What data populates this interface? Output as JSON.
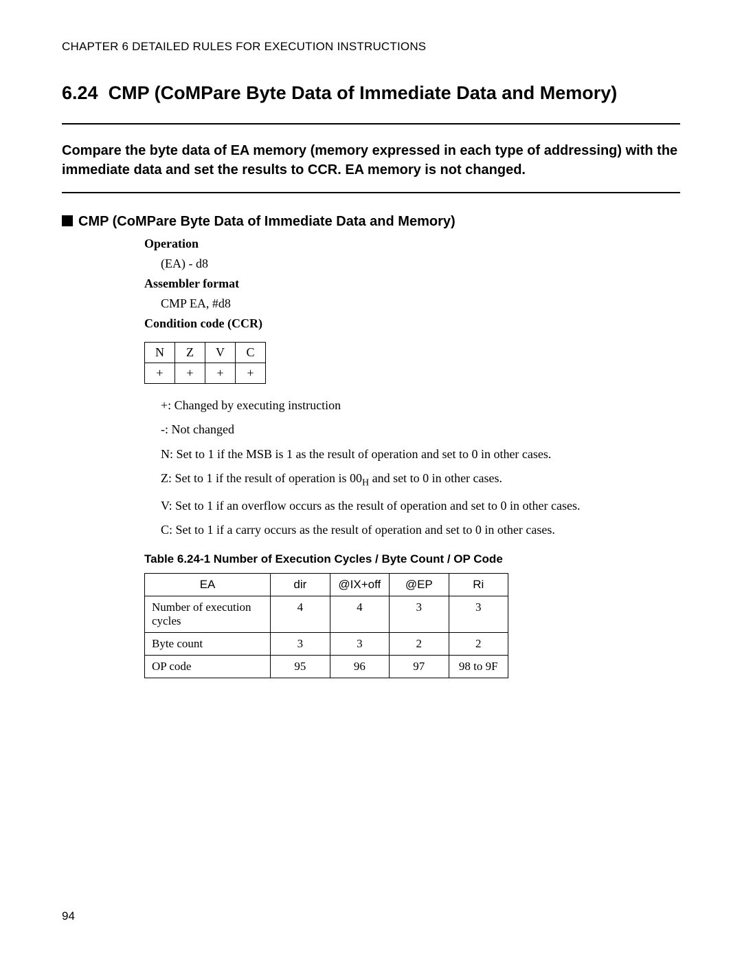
{
  "chapter_header": "CHAPTER 6  DETAILED RULES FOR EXECUTION INSTRUCTIONS",
  "section_number": "6.24",
  "section_title": "CMP (CoMPare Byte Data of Immediate Data and Memory)",
  "intro": "Compare the byte data of EA memory (memory expressed in each type of addressing) with the immediate data and set the results to CCR. EA memory is not changed.",
  "subheading": "CMP (CoMPare Byte Data of Immediate Data and Memory)",
  "operation_label": "Operation",
  "operation_value": "(EA) - d8",
  "assembler_label": "Assembler format",
  "assembler_value": "CMP EA, #d8",
  "ccr_label": "Condition code (CCR)",
  "ccr_headers": [
    "N",
    "Z",
    "V",
    "C"
  ],
  "ccr_values": [
    "+",
    "+",
    "+",
    "+"
  ],
  "notes": {
    "plus": "+: Changed by executing instruction",
    "dash": "-: Not changed",
    "n": "N: Set to 1 if the MSB is 1 as the result of operation and set to 0 in other cases.",
    "z_pre": "Z: Set to 1 if the result of operation is 00",
    "z_sub": "H",
    "z_post": " and set to 0 in other cases.",
    "v": "V: Set to 1 if an overflow occurs as the result of operation and set to 0 in other cases.",
    "c": "C: Set to 1 if a carry occurs as the result of operation and set to 0 in other cases."
  },
  "table_caption": "Table 6.24-1  Number of Execution Cycles / Byte Count / OP Code",
  "detail_headers": [
    "EA",
    "dir",
    "@IX+off",
    "@EP",
    "Ri"
  ],
  "detail_rows": [
    {
      "label": "Number of execution cycles",
      "cells": [
        "4",
        "4",
        "3",
        "3"
      ]
    },
    {
      "label": "Byte count",
      "cells": [
        "3",
        "3",
        "2",
        "2"
      ]
    },
    {
      "label": "OP code",
      "cells": [
        "95",
        "96",
        "97",
        "98 to 9F"
      ]
    }
  ],
  "page_number": "94"
}
